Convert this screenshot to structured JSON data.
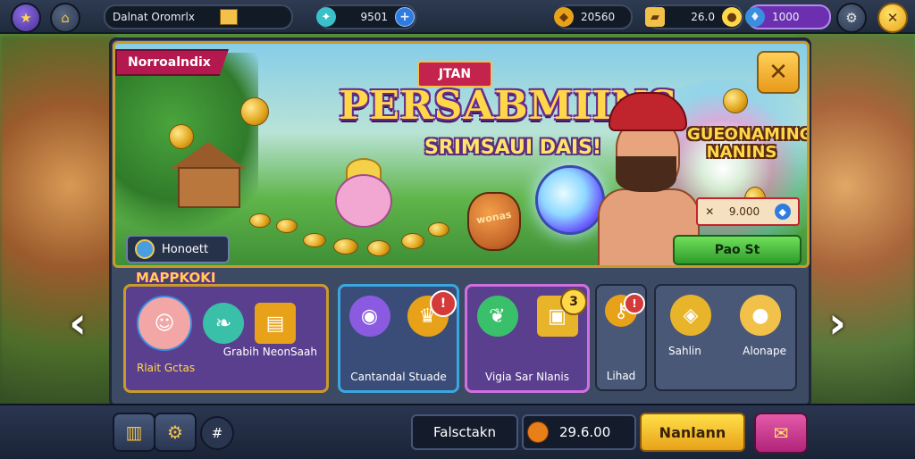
{
  "topbar": {
    "player_name": "Dalnat Oromrlx",
    "energy_value": "9501",
    "coins_value": "20560",
    "tickets_value": "26.0",
    "gems_value": "1000"
  },
  "banner": {
    "corner_tag": "Norroalndix",
    "title_badge": "JTAN",
    "title": "PERSABMIINS",
    "subtitle": "SRIMSAUI DAIS!",
    "side_sign": "GUEONAMING NANINS",
    "pot_label": "wonas",
    "price_text": "9.000",
    "buy_button": "Pao St",
    "left_pill": "Honoett",
    "close_icon": "close-icon"
  },
  "section": {
    "label": "MAPPKOKI"
  },
  "tiles": [
    {
      "label": "Grabih NeonSaah",
      "sublabel": "Rlait Gctas"
    },
    {
      "label": "Cantandal Stuade",
      "badge": "!"
    },
    {
      "label": "Vigia Sar Nlanis",
      "badge": "3"
    },
    {
      "label": "Lihad",
      "badge": "!"
    },
    {
      "label": "Sahlin"
    },
    {
      "label": "Alonape"
    }
  ],
  "bottombar": {
    "search_label": "Falsctakn",
    "amount_value": "29.6.00",
    "primary_button": "Nanlann"
  },
  "colors": {
    "accent_gold": "#e8a21a",
    "ribbon": "#b3194e",
    "panel": "#3d4a63",
    "purple_tile": "#5b3f8f",
    "gem": "#8f4de0"
  }
}
